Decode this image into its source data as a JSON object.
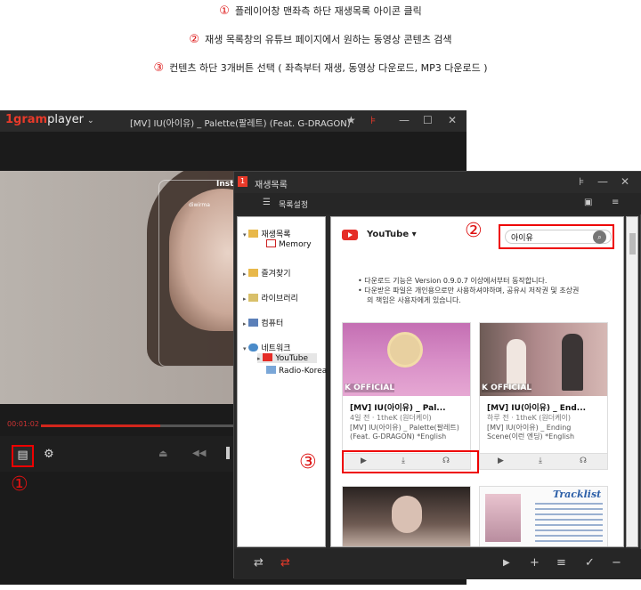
{
  "instructions": [
    {
      "num": "①",
      "text": "플레이어창 맨좌측 하단 재생목록 아이콘 클릭"
    },
    {
      "num": "②",
      "text": "재생 목록창의 유튜브 페이지에서 원하는 동영상 콘텐츠 검색"
    },
    {
      "num": "③",
      "text": "컨텐츠 하단 3개버튼 선택 ( 좌측부터 재생, 동영상 다운로드, MP3 다운로드 )"
    }
  ],
  "player": {
    "logo_brand": "1gram",
    "logo_word": "player",
    "title": "[MV] IU(아이유) _ Palette(팔레트) (Feat. G-DRAGON)",
    "time": "00:01:02",
    "progress": 0.28,
    "video_overlay_insta": "Insta",
    "video_overlay_user": "diwirma"
  },
  "callouts": {
    "c1": "①",
    "c2": "②",
    "c3": "③"
  },
  "playlist": {
    "title": "재생목록",
    "list_settings": "목록설정",
    "tree": [
      {
        "label": "재생목록"
      },
      {
        "label": "Memory"
      },
      {
        "label": "즐겨찾기"
      },
      {
        "label": "라이브러리"
      },
      {
        "label": "컴퓨터"
      },
      {
        "label": "네트워크"
      },
      {
        "label": "YouTube"
      },
      {
        "label": "Radio-Korea"
      }
    ],
    "source": "YouTube ▾",
    "search_value": "아이유",
    "notice": [
      "다운로드 기능은 Version 0.9.0.7 이상에서부터 동작합니다.",
      "다운받은 파일은 개인용으로만 사용하셔야하며, 공유시 저작권 및 초상권",
      "의 책임은 사용자에게 있습니다."
    ],
    "cards": [
      {
        "title": "[MV] IU(아이유) _ Pal...",
        "meta": "4일 전  ·  1theK (원더케이)",
        "desc": "[MV] IU(아이유) _ Palette(팔레트) (Feat. G-DRAGON) *English",
        "badge": "OFFICIAL",
        "k": "K"
      },
      {
        "title": "[MV] IU(아이유) _ End...",
        "meta": "하루 전  ·  1theK (원더케이)",
        "desc": "[MV] IU(아이유) _ Ending Scene(이런 엔딩) *English",
        "badge": "OFFICIAL",
        "k": "K"
      }
    ],
    "tracklist_label": "Tracklist",
    "colors": {
      "accent": "#e83a2a",
      "highlight": "#ee0000"
    }
  }
}
